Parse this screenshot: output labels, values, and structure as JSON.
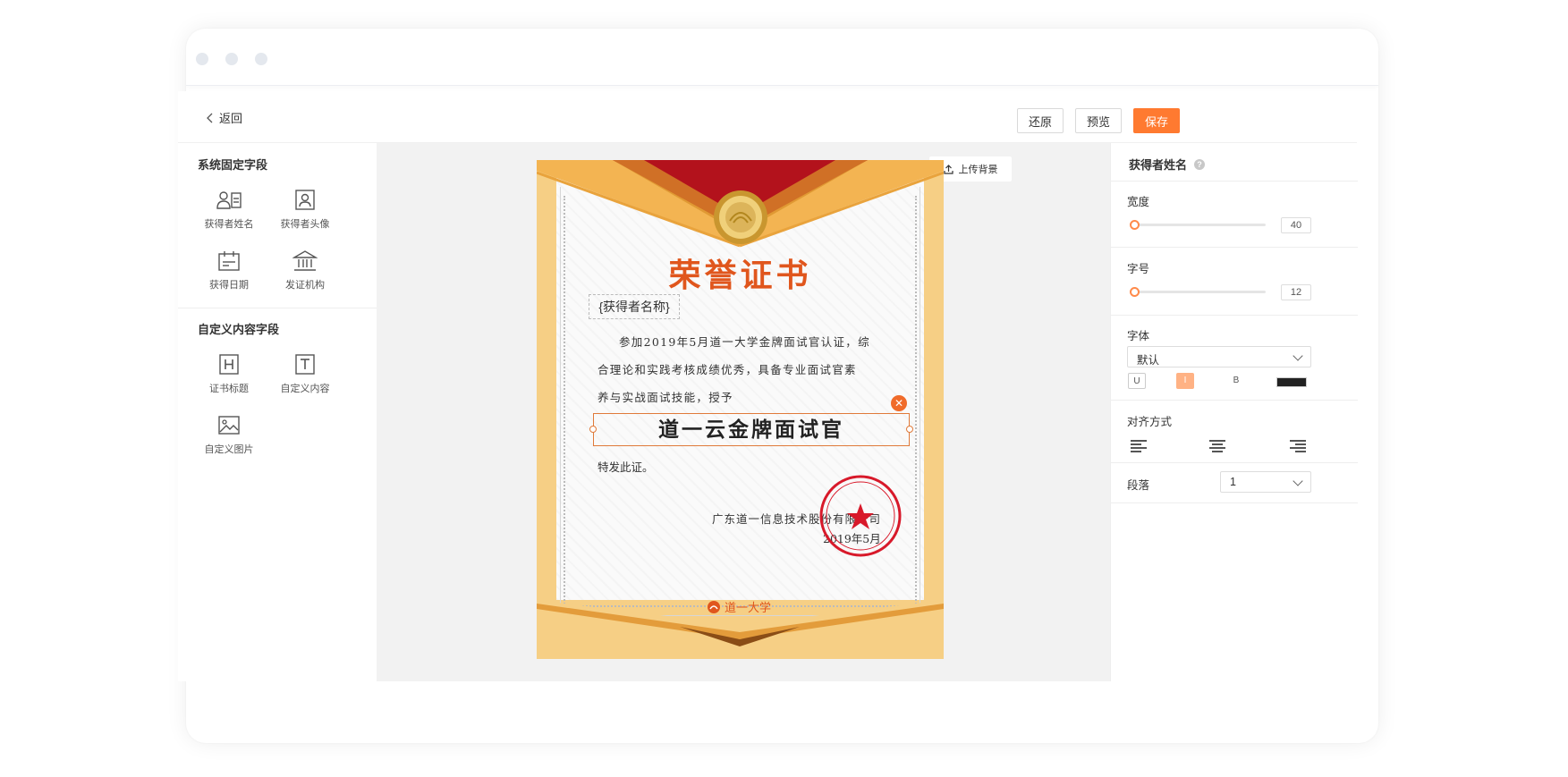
{
  "toolbar": {
    "back_label": "返回",
    "restore_label": "还原",
    "preview_label": "预览",
    "save_label": "保存",
    "accent_color": "#ff7a30"
  },
  "left_panel": {
    "fixed_section_title": "系统固定字段",
    "fixed_fields": [
      {
        "label": "获得者姓名",
        "icon": "id-card-icon"
      },
      {
        "label": "获得者头像",
        "icon": "portrait-icon"
      },
      {
        "label": "获得日期",
        "icon": "calendar-icon"
      },
      {
        "label": "发证机构",
        "icon": "institution-icon"
      }
    ],
    "custom_section_title": "自定义内容字段",
    "custom_fields": [
      {
        "label": "证书标题",
        "icon": "heading-icon"
      },
      {
        "label": "自定义内容",
        "icon": "text-icon"
      },
      {
        "label": "自定义图片",
        "icon": "image-icon"
      }
    ]
  },
  "canvas": {
    "upload_label": "上传背景"
  },
  "certificate": {
    "title": "荣誉证书",
    "name_placeholder": "{获得者名称}",
    "body_line1": "参加2019年5月道一大学金牌面试官认证，综",
    "body_line2": "合理论和实践考核成绩优秀，具备专业面试官素",
    "body_line3": "养与实战面试技能，授予",
    "award": "道一云金牌面试官",
    "note": "特发此证。",
    "org": "广东道一信息技术股份有限公司",
    "date": "2019年5月",
    "logo_text": "道一大学",
    "title_color": "#e0561d"
  },
  "right_panel": {
    "header": "获得者姓名",
    "width_label": "宽度",
    "width_value": "40",
    "font_size_label": "字号",
    "font_size_value": "12",
    "font_label": "字体",
    "font_value": "默认",
    "style_underline": "U",
    "style_italic": "I",
    "style_bold": "B",
    "text_color": "#222222",
    "align_label": "对齐方式",
    "paragraph_label": "段落",
    "paragraph_value": "1"
  }
}
